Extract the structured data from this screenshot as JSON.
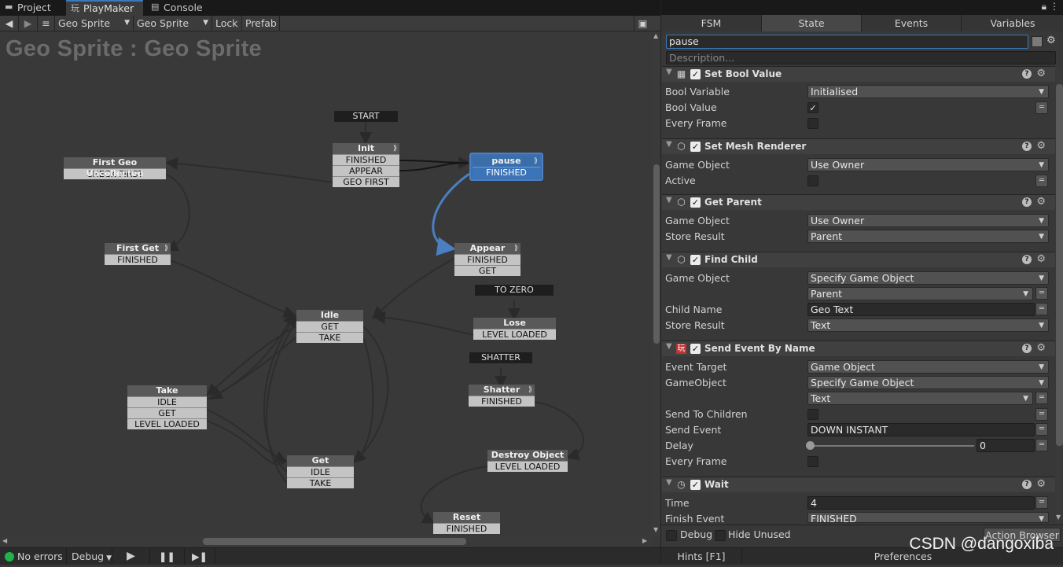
{
  "top_tabs": [
    {
      "label": "Project",
      "icon": "folder-icon"
    },
    {
      "label": "PlayMaker",
      "icon": "playmaker-icon"
    },
    {
      "label": "Console",
      "icon": "console-icon"
    }
  ],
  "toolbar": {
    "nav_back": "◀",
    "nav_forward": "▶",
    "menu_icon": "≡",
    "object_select": "Geo Sprite",
    "fsm_select": "Geo Sprite",
    "lock_label": "Lock",
    "prefab_label": "Prefab"
  },
  "graph": {
    "title": "Geo Sprite : Geo Sprite",
    "global_events": {
      "start": "START",
      "to_zero": "TO ZERO",
      "shatter": "SHATTER"
    },
    "states": {
      "init": {
        "name": "Init",
        "transitions": [
          "FINISHED",
          "APPEAR",
          "GEO FIRST"
        ]
      },
      "pause": {
        "name": "pause",
        "transitions": [
          "FINISHED"
        ]
      },
      "first_geo_uncollected": {
        "name": "First Geo Uncollected",
        "transitions": [
          "CHECK FIRST"
        ]
      },
      "first_get": {
        "name": "First Get",
        "transitions": [
          "FINISHED"
        ]
      },
      "appear": {
        "name": "Appear",
        "transitions": [
          "FINISHED",
          "GET"
        ]
      },
      "lose": {
        "name": "Lose",
        "transitions": [
          "LEVEL LOADED"
        ]
      },
      "idle": {
        "name": "Idle",
        "transitions": [
          "GET",
          "TAKE"
        ]
      },
      "take": {
        "name": "Take",
        "transitions": [
          "IDLE",
          "GET",
          "LEVEL LOADED"
        ]
      },
      "shatter": {
        "name": "Shatter",
        "transitions": [
          "FINISHED"
        ]
      },
      "get": {
        "name": "Get",
        "transitions": [
          "IDLE",
          "TAKE"
        ]
      },
      "destroy_object": {
        "name": "Destroy Object",
        "transitions": [
          "LEVEL LOADED"
        ]
      },
      "reset": {
        "name": "Reset",
        "transitions": [
          "FINISHED"
        ]
      }
    }
  },
  "status": {
    "errors": "No errors",
    "debug": "Debug",
    "hints": "Hints [F1]",
    "preferences": "Preferences"
  },
  "inspector": {
    "tabs": [
      "FSM",
      "State",
      "Events",
      "Variables"
    ],
    "state_name": "pause",
    "description_placeholder": "Description...",
    "actions": [
      {
        "title": "Set Bool Value",
        "icon": "grid-icon",
        "fields": [
          {
            "label": "Bool Variable",
            "type": "dropdown",
            "value": "Initialised"
          },
          {
            "label": "Bool Value",
            "type": "check",
            "value": "✓"
          },
          {
            "label": "Every Frame",
            "type": "check",
            "value": ""
          }
        ]
      },
      {
        "title": "Set Mesh Renderer",
        "icon": "cube-icon",
        "fields": [
          {
            "label": "Game Object",
            "type": "dropdown",
            "value": "Use Owner"
          },
          {
            "label": "Active",
            "type": "check",
            "value": ""
          }
        ]
      },
      {
        "title": "Get Parent",
        "icon": "cube-icon",
        "fields": [
          {
            "label": "Game Object",
            "type": "dropdown",
            "value": "Use Owner"
          },
          {
            "label": "Store Result",
            "type": "dropdown",
            "value": "Parent"
          }
        ]
      },
      {
        "title": "Find Child",
        "icon": "cube-icon",
        "fields": [
          {
            "label": "Game Object",
            "type": "dropdown",
            "value": "Specify Game Object"
          },
          {
            "label": "",
            "type": "dropdown",
            "value": "Parent"
          },
          {
            "label": "Child Name",
            "type": "text",
            "value": "Geo Text"
          },
          {
            "label": "Store Result",
            "type": "dropdown",
            "value": "Text"
          }
        ]
      },
      {
        "title": "Send Event By Name",
        "icon": "playmaker-icon",
        "fields": [
          {
            "label": "Event Target",
            "type": "dropdown",
            "value": "Game Object"
          },
          {
            "label": "GameObject",
            "type": "dropdown",
            "value": "Specify Game Object"
          },
          {
            "label": "",
            "type": "dropdown",
            "value": "Text"
          },
          {
            "label": "Send To Children",
            "type": "check",
            "value": ""
          },
          {
            "label": "Send Event",
            "type": "text",
            "value": "DOWN INSTANT"
          },
          {
            "label": "Delay",
            "type": "slider",
            "value": "0"
          },
          {
            "label": "Every Frame",
            "type": "check",
            "value": ""
          }
        ]
      },
      {
        "title": "Wait",
        "icon": "clock-icon",
        "fields": [
          {
            "label": "Time",
            "type": "text",
            "value": "4"
          },
          {
            "label": "Finish Event",
            "type": "dropdown",
            "value": "FINISHED"
          }
        ]
      }
    ],
    "footer": {
      "debug_label": "Debug",
      "hide_unused_label": "Hide Unused",
      "action_browser": "Action Browser"
    }
  },
  "watermark": "CSDN @dangoxiba",
  "colors": {
    "selection": "#3e6fae",
    "accent": "#3a79bb"
  }
}
